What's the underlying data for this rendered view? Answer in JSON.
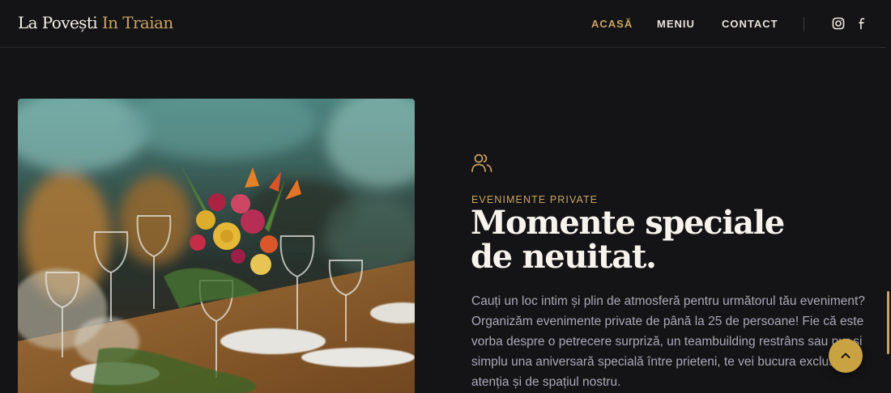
{
  "brand": {
    "name_part1": "La Povești",
    "name_part2": "In Traian"
  },
  "nav": {
    "items": [
      {
        "label": "ACASĂ",
        "active": true
      },
      {
        "label": "MENIU",
        "active": false
      },
      {
        "label": "CONTACT",
        "active": false
      }
    ]
  },
  "social": {
    "icons": [
      "instagram-icon",
      "facebook-icon"
    ]
  },
  "section": {
    "icon": "users-icon",
    "eyebrow": "EVENIMENTE PRIVATE",
    "title": "Momente speciale de neuitat.",
    "body": "Cauți un loc intim și plin de atmosferă pentru următorul tău eveniment? Organizăm evenimente private de până la 25 de persoane! Fie că este vorba despre o petrecere surpriză, un teambuilding restrâns sau pur și simplu una aniversară specială între prieteni, te vei bucura exclusiv de atenția și de spațiul nostru."
  },
  "colors": {
    "accent": "#c9a464",
    "background": "#141315",
    "button": "#c9a242"
  },
  "back_to_top": {
    "icon": "chevron-up-icon"
  }
}
